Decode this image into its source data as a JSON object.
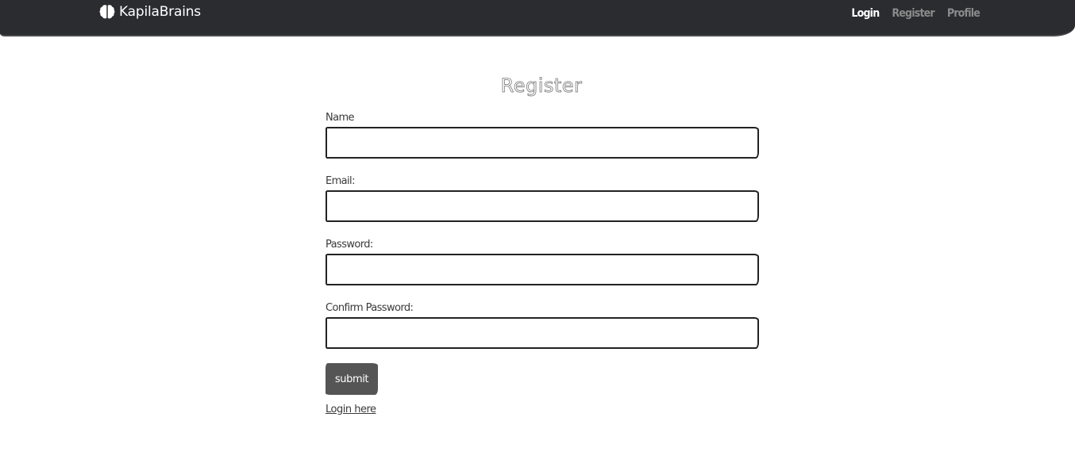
{
  "navbar": {
    "brand": {
      "icon": "brain-icon",
      "name": "KapilaBrains"
    },
    "links": [
      {
        "label": "Login",
        "active": true
      },
      {
        "label": "Register",
        "active": false
      },
      {
        "label": "Profile",
        "active": false
      }
    ],
    "colors": {
      "background": "#2b2c30",
      "active_link": "#ffffff",
      "inactive_link": "#8b8b8b"
    }
  },
  "page": {
    "title": "Register"
  },
  "form": {
    "fields": [
      {
        "label": "Name",
        "value": "",
        "placeholder": ""
      },
      {
        "label": "Email:",
        "value": "",
        "placeholder": ""
      },
      {
        "label": "Password:",
        "value": "",
        "placeholder": ""
      },
      {
        "label": "Confirm Password:",
        "value": "",
        "placeholder": ""
      }
    ],
    "submit_label": "submit",
    "submit_color": "#555555",
    "login_link_label": "Login here"
  }
}
